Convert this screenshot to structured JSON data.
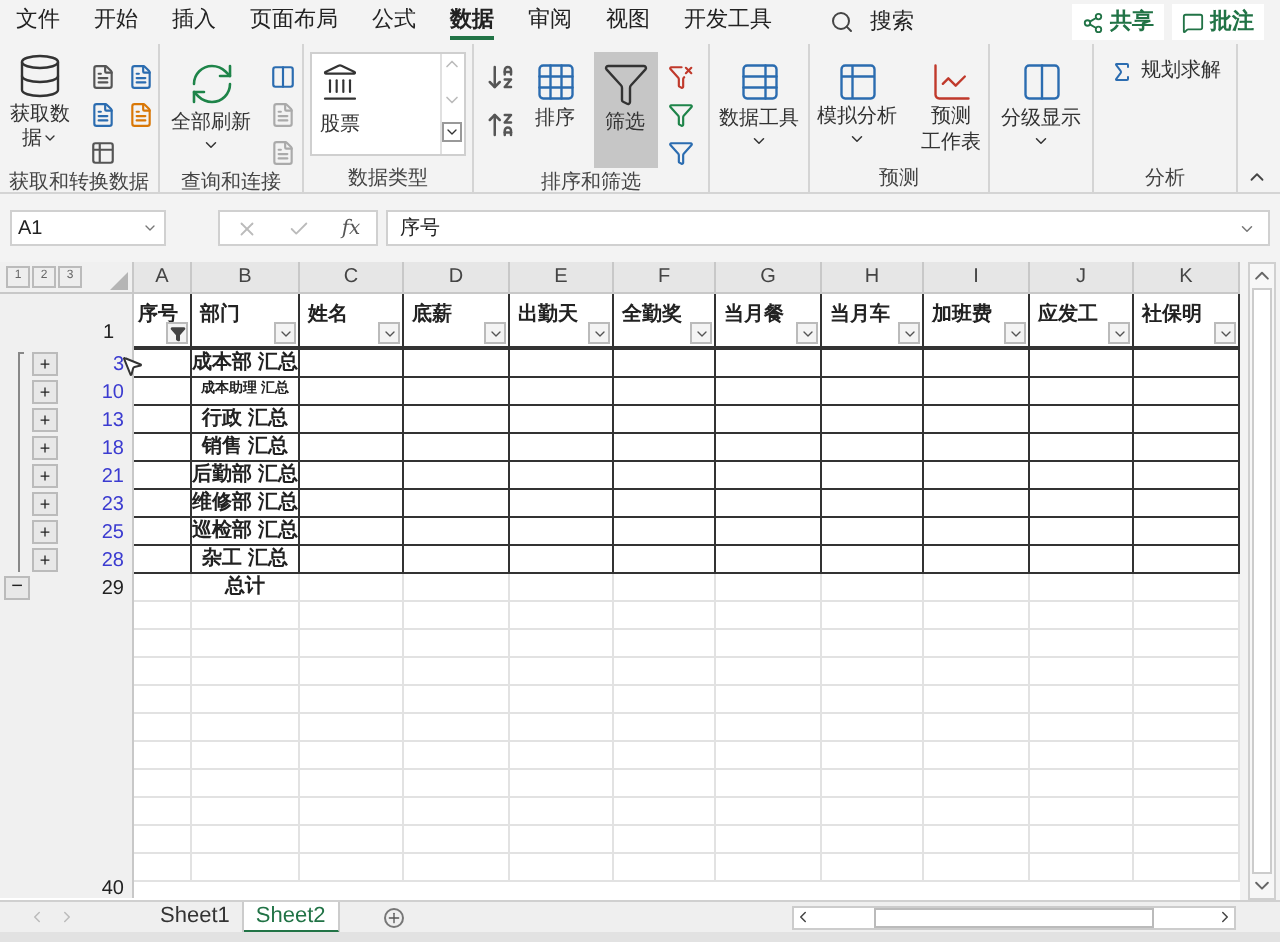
{
  "tabs": [
    {
      "label": "文件",
      "selected": false
    },
    {
      "label": "开始",
      "selected": false
    },
    {
      "label": "插入",
      "selected": false
    },
    {
      "label": "页面布局",
      "selected": false
    },
    {
      "label": "公式",
      "selected": false
    },
    {
      "label": "数据",
      "selected": true
    },
    {
      "label": "审阅",
      "selected": false
    },
    {
      "label": "视图",
      "selected": false
    },
    {
      "label": "开发工具",
      "selected": false
    }
  ],
  "search": "搜索",
  "share_button": "共享",
  "comments_button": "批注",
  "ribbon": [
    {
      "kind": "get_data",
      "label": "获取和转换数据",
      "button": "获取数据"
    },
    {
      "kind": "queries",
      "label": "查询和连接",
      "button": "全部刷新"
    },
    {
      "kind": "data_types",
      "label": "数据类型",
      "gallery_item": "股票"
    },
    {
      "kind": "sort_filter",
      "label": "排序和筛选",
      "sort": "排序",
      "filter": "筛选",
      "filter_on": true
    },
    {
      "kind": "data_tools",
      "button": "数据工具"
    },
    {
      "kind": "forecast",
      "label": "预测",
      "buttons": [
        [
          "模拟分析"
        ],
        [
          "预测",
          "工作表"
        ]
      ]
    },
    {
      "kind": "outline",
      "button": "分级显示"
    },
    {
      "kind": "analysis",
      "label": "分析",
      "button": "规划求解"
    }
  ],
  "formula_bar": {
    "name_box": "A1",
    "fx": "fx",
    "formula": "序号"
  },
  "outline_levels": [
    "1",
    "2",
    "3"
  ],
  "columns": [
    {
      "letter": "A",
      "header": "序号",
      "filtered": true
    },
    {
      "letter": "B",
      "header": "部门",
      "filtered": false
    },
    {
      "letter": "C",
      "header": "姓名",
      "filtered": false
    },
    {
      "letter": "D",
      "header": "底薪",
      "filtered": false
    },
    {
      "letter": "E",
      "header": "出勤天",
      "filtered": false
    },
    {
      "letter": "F",
      "header": "全勤奖",
      "filtered": false
    },
    {
      "letter": "G",
      "header": "当月餐",
      "filtered": false
    },
    {
      "letter": "H",
      "header": "当月车",
      "filtered": false
    },
    {
      "letter": "I",
      "header": "加班费",
      "filtered": false
    },
    {
      "letter": "J",
      "header": "应发工",
      "filtered": false
    },
    {
      "letter": "K",
      "header": "社保明",
      "filtered": false
    }
  ],
  "header_row_number": "1",
  "rows": [
    {
      "number": "3",
      "kind": "subtotal",
      "collapsed": true,
      "outline_button": "+",
      "dept": "成本部 汇总",
      "shrink": false
    },
    {
      "number": "10",
      "kind": "subtotal",
      "collapsed": true,
      "outline_button": "+",
      "dept": "成本助理 汇总",
      "shrink": true
    },
    {
      "number": "13",
      "kind": "subtotal",
      "collapsed": true,
      "outline_button": "+",
      "dept": "行政 汇总",
      "shrink": false
    },
    {
      "number": "18",
      "kind": "subtotal",
      "collapsed": true,
      "outline_button": "+",
      "dept": "销售 汇总",
      "shrink": false
    },
    {
      "number": "21",
      "kind": "subtotal",
      "collapsed": true,
      "outline_button": "+",
      "dept": "后勤部 汇总",
      "shrink": false
    },
    {
      "number": "23",
      "kind": "subtotal",
      "collapsed": true,
      "outline_button": "+",
      "dept": "维修部 汇总",
      "shrink": false
    },
    {
      "number": "25",
      "kind": "subtotal",
      "collapsed": true,
      "outline_button": "+",
      "dept": "巡检部 汇总",
      "shrink": false
    },
    {
      "number": "28",
      "kind": "subtotal",
      "collapsed": true,
      "outline_button": "+",
      "dept": "杂工 汇总",
      "shrink": false
    },
    {
      "number": "29",
      "kind": "grand_total",
      "collapsed": false,
      "outline_button": "−",
      "dept": "总计",
      "shrink": false
    }
  ],
  "last_row_number": "40",
  "sheets": [
    {
      "label": "Sheet1",
      "selected": false
    },
    {
      "label": "Sheet2",
      "selected": true
    }
  ]
}
